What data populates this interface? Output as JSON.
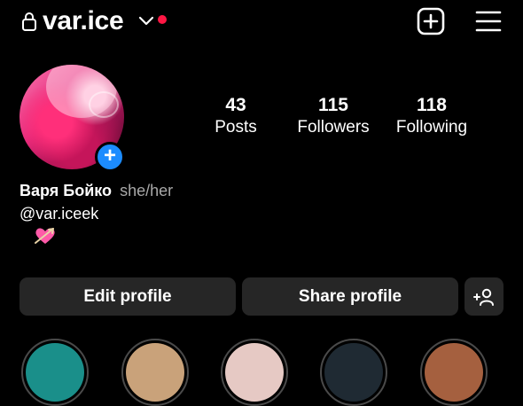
{
  "header": {
    "username": "var.ice",
    "has_notification": true,
    "notification_color": "#ff1744"
  },
  "profile": {
    "name": "Варя Бойко",
    "pronouns": "she/her",
    "handle": "@var.iceek",
    "bio_emoji": "💘"
  },
  "stats": [
    {
      "value": "43",
      "label": "Posts"
    },
    {
      "value": "115",
      "label": "Followers"
    },
    {
      "value": "118",
      "label": "Following"
    }
  ],
  "actions": {
    "edit_label": "Edit profile",
    "share_label": "Share profile"
  },
  "highlights": [
    {
      "color": "#1a8f8a"
    },
    {
      "color": "#c9a27a"
    },
    {
      "color": "#e6c9c4"
    },
    {
      "color": "#1f2a33"
    },
    {
      "color": "#a5603f"
    }
  ],
  "colors": {
    "background": "#000000",
    "button_bg": "#262626",
    "accent_blue": "#1c8cff",
    "muted_text": "#a8a8a8"
  }
}
